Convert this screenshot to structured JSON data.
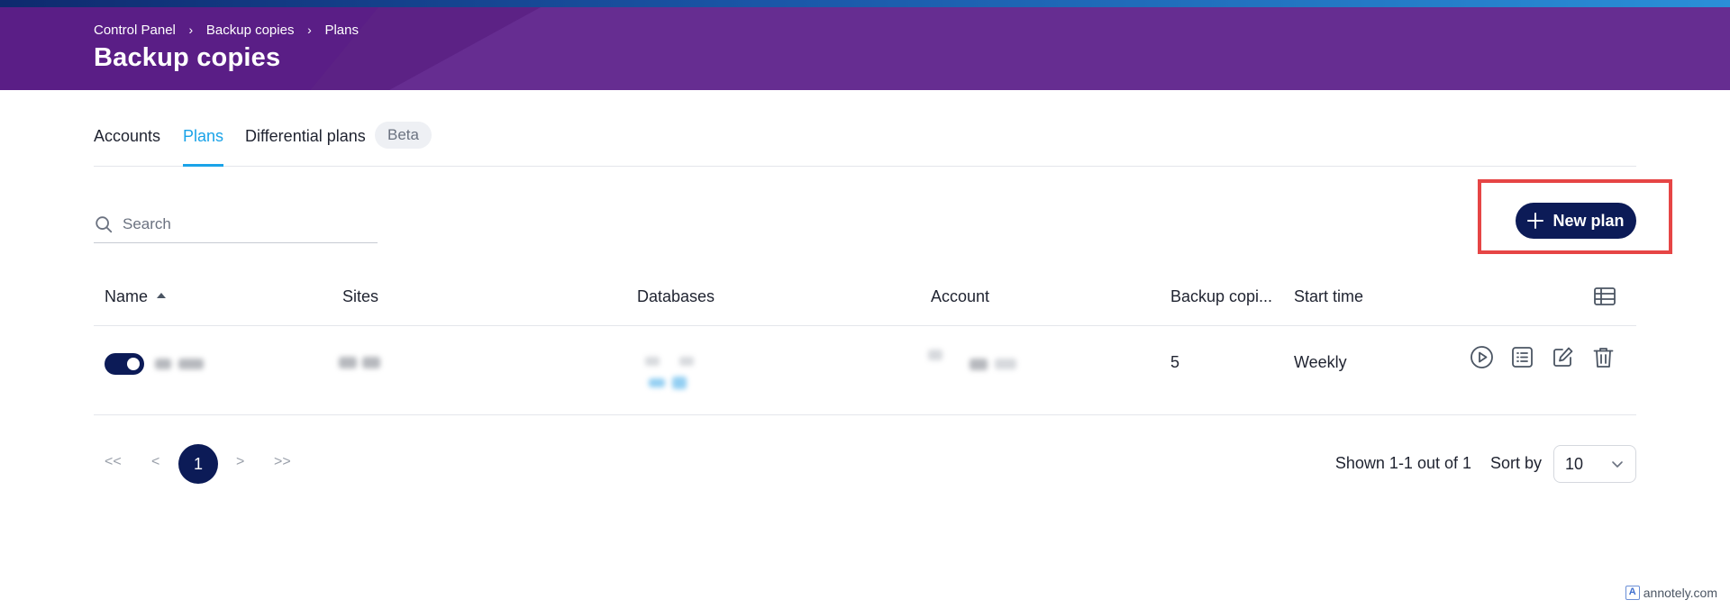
{
  "header": {
    "breadcrumb": [
      "Control Panel",
      "Backup copies",
      "Plans"
    ],
    "title": "Backup copies"
  },
  "tabs": [
    {
      "label": "Accounts",
      "active": false
    },
    {
      "label": "Plans",
      "active": true
    },
    {
      "label": "Differential plans",
      "active": false,
      "badge": "Beta"
    }
  ],
  "search": {
    "placeholder": "Search",
    "icon": "search-icon"
  },
  "new_plan_button": {
    "label": "New plan",
    "icon": "plus-icon"
  },
  "table": {
    "columns": [
      "Name",
      "Sites",
      "Databases",
      "Account",
      "Backup copi...",
      "Start time"
    ],
    "sorted_column": "Name",
    "sort_direction": "ascending",
    "rows": [
      {
        "enabled": true,
        "backup_copies": "5",
        "start_time": "Weekly",
        "actions": [
          "play-icon",
          "list-icon",
          "edit-icon",
          "trash-icon"
        ]
      }
    ]
  },
  "pagination": {
    "first": "<<",
    "prev": "<",
    "current_page": "1",
    "next": ">",
    "last": ">>",
    "shown_text": "Shown 1-1 out of 1",
    "sort_by_label": "Sort by",
    "page_size": "10"
  },
  "colors": {
    "header_bg": "#662d91",
    "accent": "#1aa3e8",
    "primary_dark": "#0c1b57",
    "highlight": "#e64545"
  },
  "watermark": {
    "text": "annotely.com"
  }
}
